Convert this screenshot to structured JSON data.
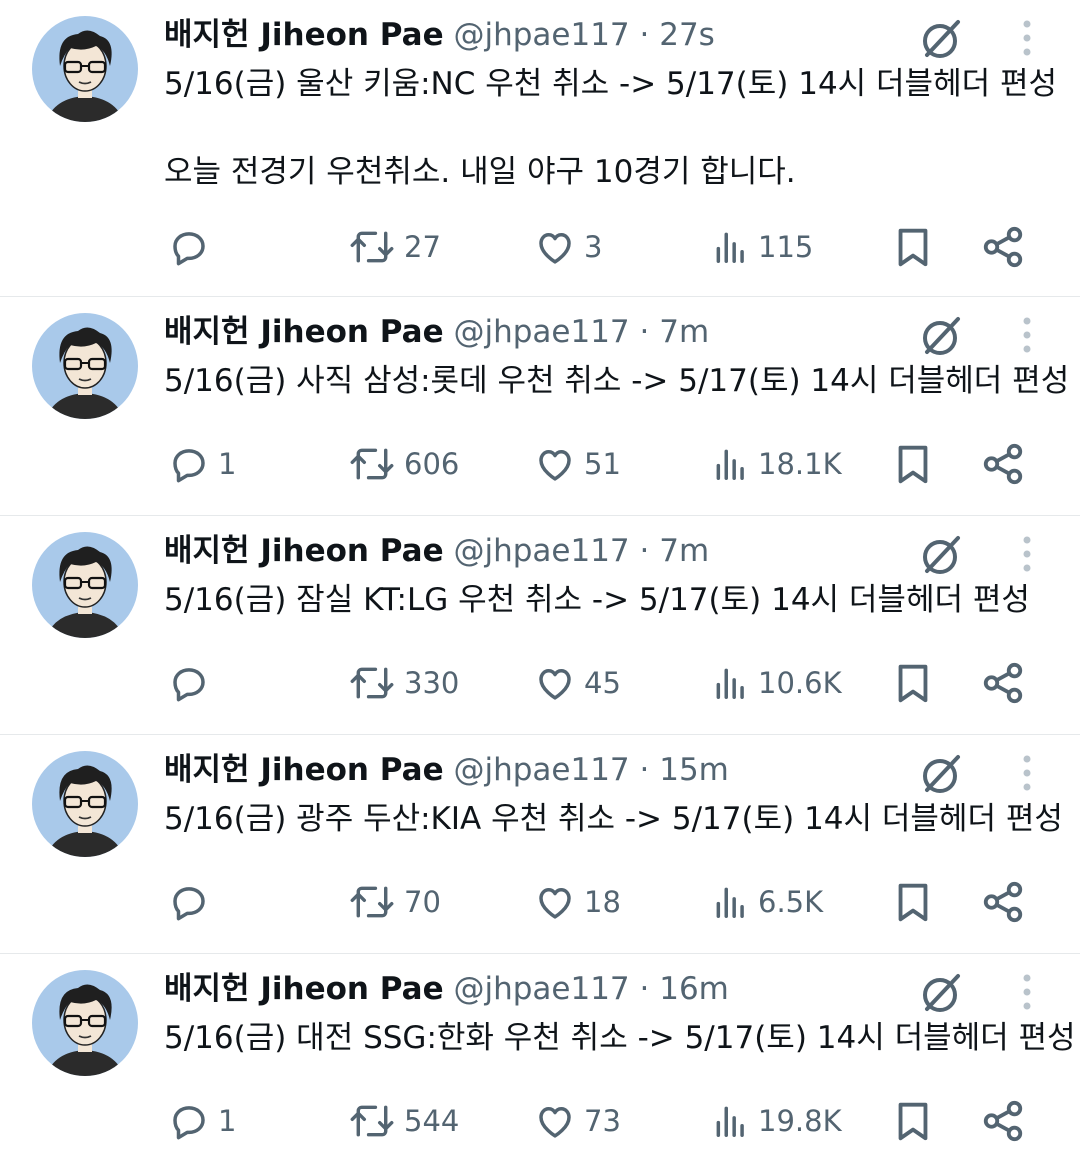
{
  "colors": {
    "text": "#0f1419",
    "muted": "#536471",
    "divider": "#e6e9eb",
    "avatar_bg": "#a9c9ea"
  },
  "icons": [
    "reply-icon",
    "retweet-icon",
    "like-icon",
    "views-icon",
    "bookmark-icon",
    "share-icon",
    "grok-icon",
    "more-icon"
  ],
  "tweets": [
    {
      "name": "배지헌 Jiheon Pae",
      "handle": "@jhpae117",
      "sep": "·",
      "time": "27s",
      "lines": [
        "5/16(금) 울산 키움:NC 우천 취소 -> 5/17(토) 14시 더블헤더 편성",
        "오늘 전경기 우천취소. 내일 야구 10경기 합니다."
      ],
      "replies": "",
      "retweets": "27",
      "likes": "3",
      "views": "115"
    },
    {
      "name": "배지헌 Jiheon Pae",
      "handle": "@jhpae117",
      "sep": "·",
      "time": "7m",
      "lines": [
        "5/16(금) 사직 삼성:롯데 우천 취소 -> 5/17(토) 14시 더블헤더 편성"
      ],
      "replies": "1",
      "retweets": "606",
      "likes": "51",
      "views": "18.1K"
    },
    {
      "name": "배지헌 Jiheon Pae",
      "handle": "@jhpae117",
      "sep": "·",
      "time": "7m",
      "lines": [
        "5/16(금) 잠실 KT:LG 우천 취소 -> 5/17(토) 14시 더블헤더 편성"
      ],
      "replies": "",
      "retweets": "330",
      "likes": "45",
      "views": "10.6K"
    },
    {
      "name": "배지헌 Jiheon Pae",
      "handle": "@jhpae117",
      "sep": "·",
      "time": "15m",
      "lines": [
        "5/16(금) 광주 두산:KIA 우천 취소 -> 5/17(토) 14시 더블헤더 편성"
      ],
      "replies": "",
      "retweets": "70",
      "likes": "18",
      "views": "6.5K"
    },
    {
      "name": "배지헌 Jiheon Pae",
      "handle": "@jhpae117",
      "sep": "·",
      "time": "16m",
      "lines": [
        "5/16(금) 대전 SSG:한화 우천 취소 -> 5/17(토) 14시 더블헤더 편성"
      ],
      "replies": "1",
      "retweets": "544",
      "likes": "73",
      "views": "19.8K"
    }
  ]
}
